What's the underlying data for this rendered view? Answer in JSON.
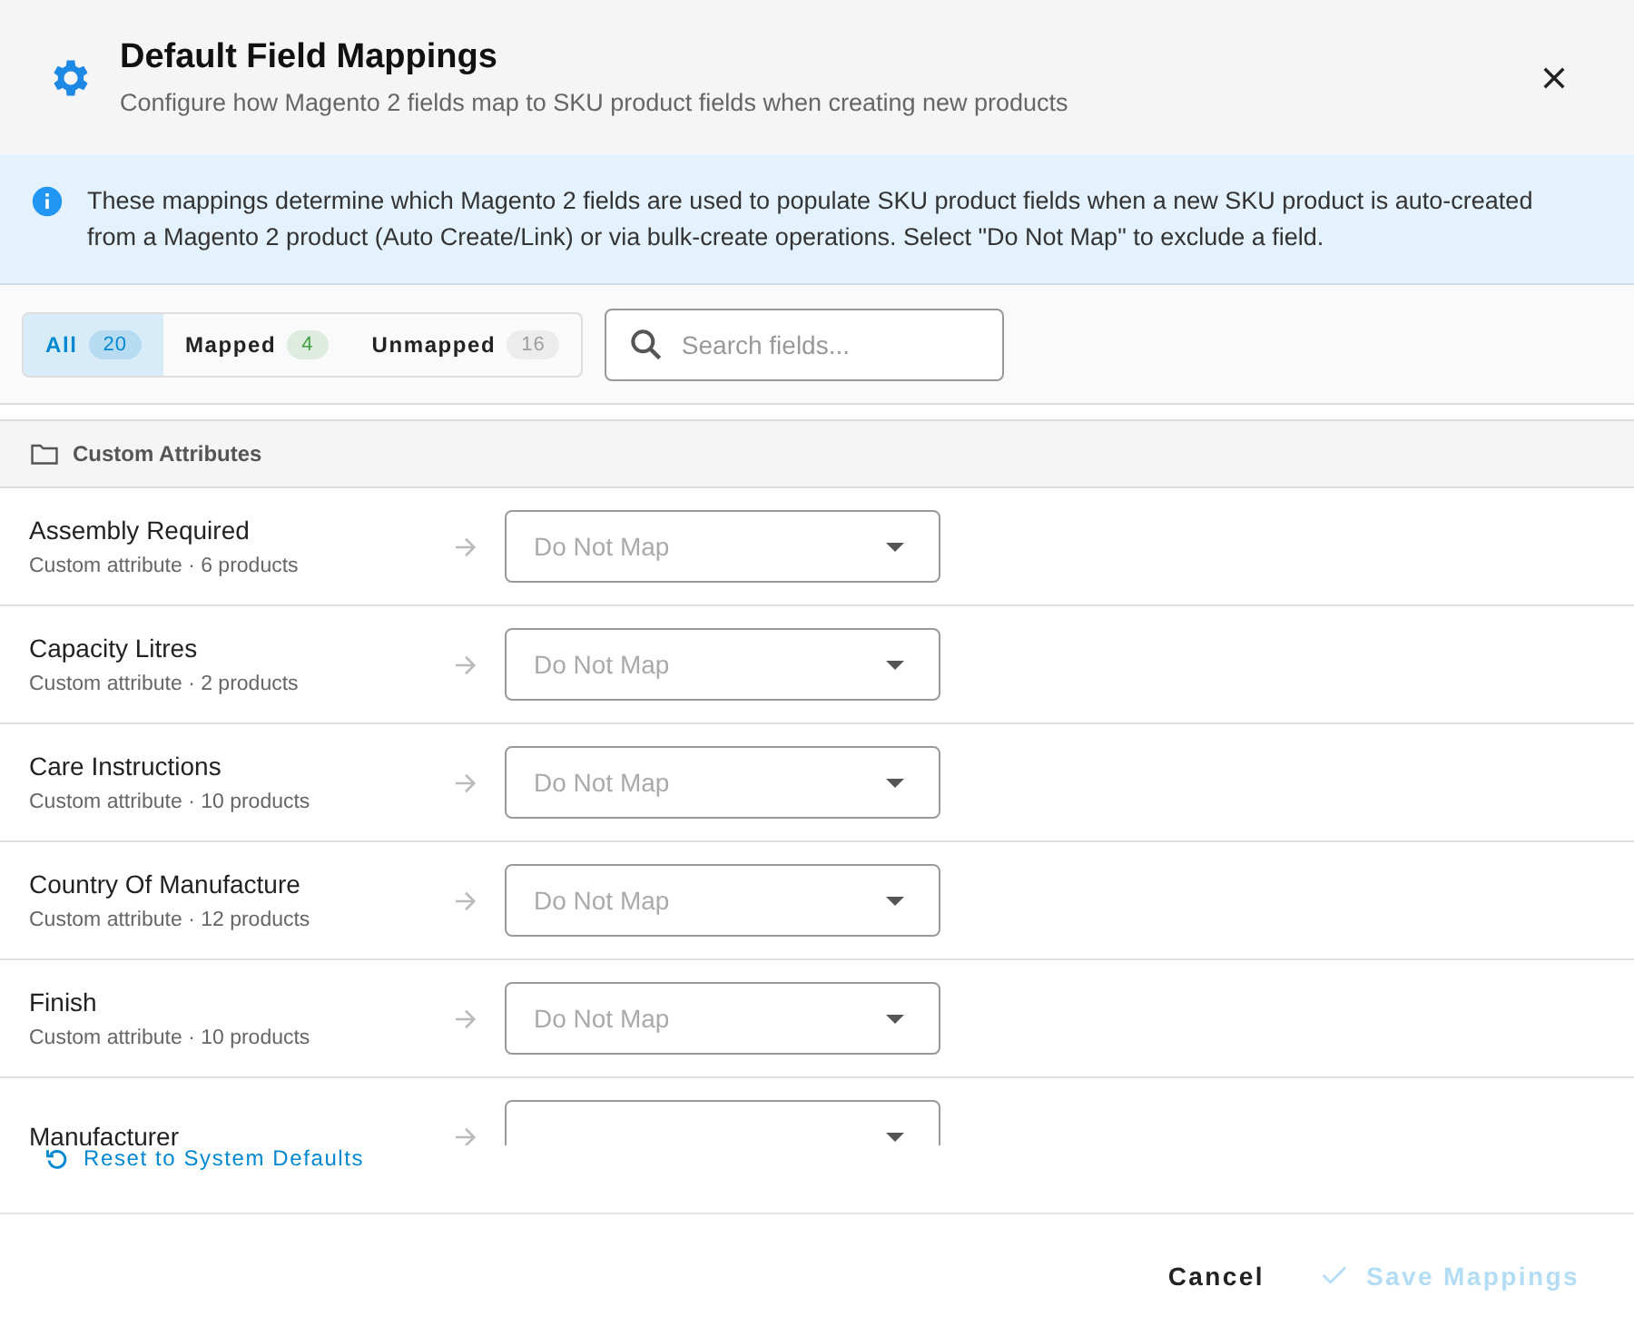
{
  "dialog": {
    "title": "Default Field Mappings",
    "subtitle": "Configure how Magento 2 fields map to SKU product fields when creating new products"
  },
  "info": {
    "text": "These mappings determine which Magento 2 fields are used to populate SKU product fields when a new SKU product is auto-created from a Magento 2 product (Auto Create/Link) or via bulk-create operations. Select \"Do Not Map\" to exclude a field."
  },
  "filter_tabs": [
    {
      "label": "All",
      "count": "20",
      "selected": true,
      "color": "#0288d1"
    },
    {
      "label": "Mapped",
      "count": "4",
      "selected": false,
      "color": "#43a047"
    },
    {
      "label": "Unmapped",
      "count": "16",
      "selected": false,
      "color": "#9e9e9e"
    }
  ],
  "search": {
    "placeholder": "Search fields..."
  },
  "section": {
    "title": "Custom Attributes"
  },
  "fields": [
    {
      "name": "Assembly Required",
      "detail": "Custom attribute · 6 products",
      "mapping": "Do Not Map"
    },
    {
      "name": "Capacity Litres",
      "detail": "Custom attribute · 2 products",
      "mapping": "Do Not Map"
    },
    {
      "name": "Care Instructions",
      "detail": "Custom attribute · 10 products",
      "mapping": "Do Not Map"
    },
    {
      "name": "Country Of Manufacture",
      "detail": "Custom attribute · 12 products",
      "mapping": "Do Not Map"
    },
    {
      "name": "Finish",
      "detail": "Custom attribute · 10 products",
      "mapping": "Do Not Map"
    },
    {
      "name": "Manufacturer"
    }
  ],
  "reset_link": "Reset to System Defaults",
  "buttons": {
    "cancel": "Cancel",
    "save": {
      "label": "Save Mappings",
      "disabled": true
    }
  }
}
